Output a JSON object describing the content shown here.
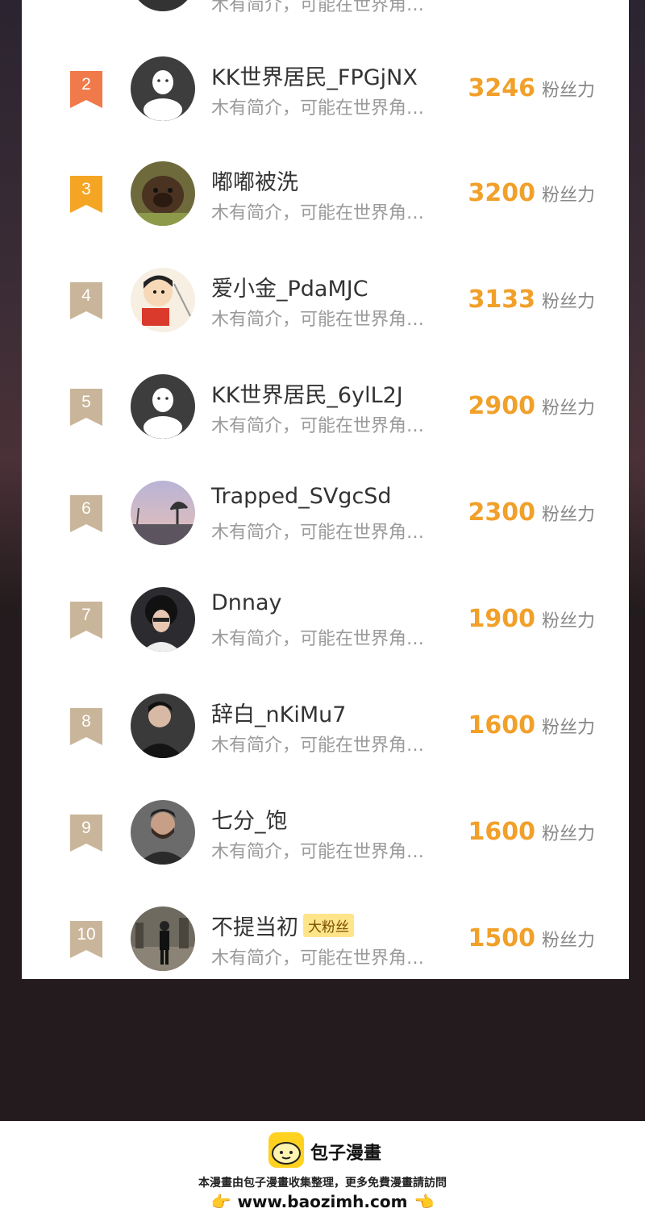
{
  "list": {
    "items": [
      {
        "rank": "2",
        "name": "KK世界居民_FPGjNX",
        "desc": "木有简介，可能在世界角…",
        "score": "3246",
        "unit": "粉丝力",
        "badge_color": "#f07a4a",
        "avatar": "default-avatar-icon"
      },
      {
        "rank": "3",
        "name": "嘟嘟被洗",
        "desc": "木有简介，可能在世界角…",
        "score": "3200",
        "unit": "粉丝力",
        "badge_color": "#f5a524",
        "avatar": "dog-photo"
      },
      {
        "rank": "4",
        "name": "爱小金_PdaMJC",
        "desc": "木有简介，可能在世界角…",
        "score": "3133",
        "unit": "粉丝力",
        "badge_color": "#c9b59a",
        "avatar": "cartoon-boy"
      },
      {
        "rank": "5",
        "name": "KK世界居民_6ylL2J",
        "desc": "木有简介，可能在世界角…",
        "score": "2900",
        "unit": "粉丝力",
        "badge_color": "#c9b59a",
        "avatar": "default-avatar-icon"
      },
      {
        "rank": "6",
        "name": "Trapped_SVgcSd",
        "desc": "木有简介，可能在世界角…",
        "score": "2300",
        "unit": "粉丝力",
        "badge_color": "#c9b59a",
        "avatar": "sunset-landscape"
      },
      {
        "rank": "7",
        "name": "Dnnay",
        "desc": "木有简介，可能在世界角…",
        "score": "1900",
        "unit": "粉丝力",
        "badge_color": "#c9b59a",
        "avatar": "curly-hair-portrait"
      },
      {
        "rank": "8",
        "name": "辞白_nKiMu7",
        "desc": "木有简介，可能在世界角…",
        "score": "1600",
        "unit": "粉丝力",
        "badge_color": "#c9b59a",
        "avatar": "dark-portrait"
      },
      {
        "rank": "9",
        "name": "七分_饱",
        "desc": "木有简介，可能在世界角…",
        "score": "1600",
        "unit": "粉丝力",
        "badge_color": "#c9b59a",
        "avatar": "bearded-portrait"
      },
      {
        "rank": "10",
        "name": "不提当初",
        "badge": "大粉丝",
        "desc": "木有简介，可能在世界角…",
        "score": "1500",
        "unit": "粉丝力",
        "badge_color": "#c9b59a",
        "avatar": "street-photo"
      }
    ]
  },
  "footer": {
    "brand": "包子漫畫",
    "line": "本漫畫由包子漫畫收集整理，更多免費漫畫請訪問",
    "url": "www.baozimh.com"
  },
  "colors": {
    "score": "#f1a02a",
    "rank_top2": "#f07a4a",
    "rank_top3": "#f5a524",
    "rank_other": "#c9b59a"
  }
}
